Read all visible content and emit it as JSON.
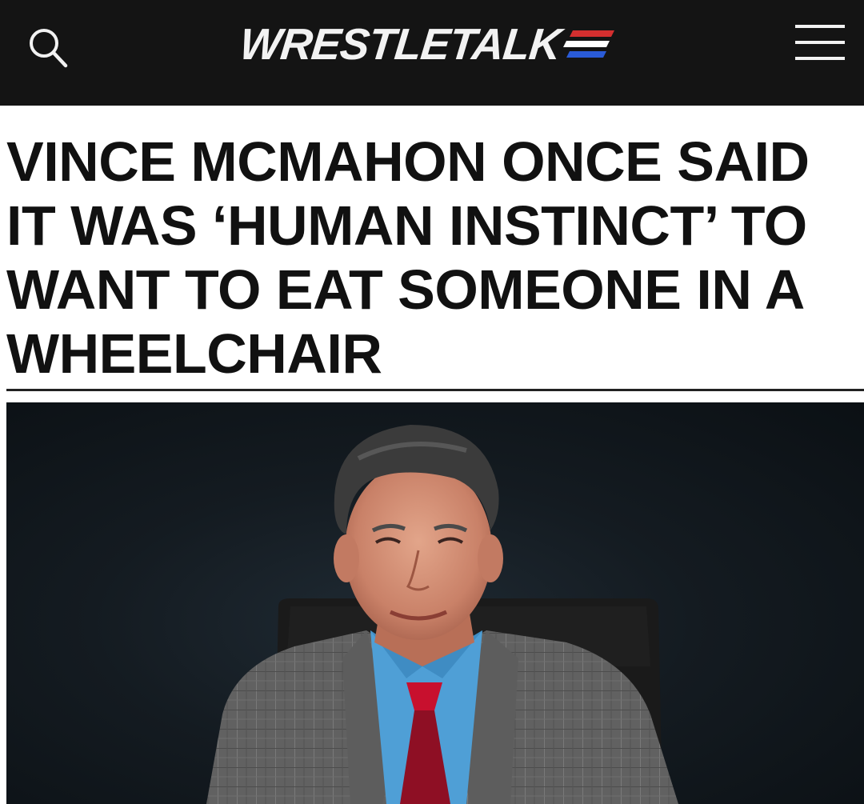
{
  "header": {
    "logo_text": "WRESTLETALK",
    "search_icon": "search-icon",
    "menu_icon": "hamburger-menu-icon"
  },
  "article": {
    "headline": "VINCE MCMAHON ONCE SAID IT WAS ‘HUMAN INSTINCT’ TO WANT TO EAT SOMEONE IN A WHEELCHAIR"
  },
  "colors": {
    "topbar": "#141414",
    "flag_red": "#d32f2f",
    "flag_white": "#ffffff",
    "flag_blue": "#2a5bd7"
  }
}
